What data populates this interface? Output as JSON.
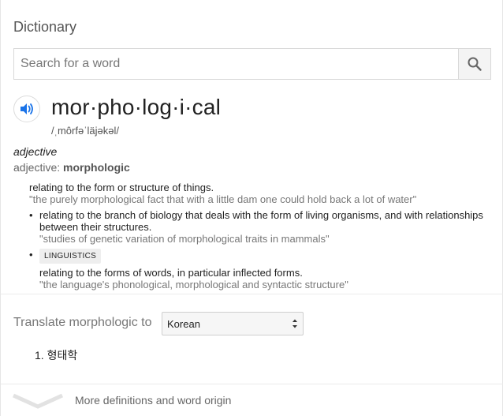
{
  "header": {
    "title": "Dictionary"
  },
  "search": {
    "placeholder": "Search for a word",
    "value": ""
  },
  "entry": {
    "headword": "mor·pho·log·i·cal",
    "phonetic": "/ˌmôrfəˈläjəkəl/",
    "part_of_speech": "adjective",
    "variant_prefix": "adjective:",
    "variant_word": "morphologic",
    "senses": [
      {
        "definition": "relating to the form or structure of things.",
        "example": "\"the purely morphological fact that with a little dam one could hold back a lot of water\""
      }
    ],
    "subsenses": [
      {
        "bullet": "•",
        "tag": "",
        "definition": "relating to the branch of biology that deals with the form of living organisms, and with relationships between their structures.",
        "example": "\"studies of genetic variation of morphological traits in mammals\""
      },
      {
        "bullet": "•",
        "tag": "LINGUISTICS",
        "definition": "relating to the forms of words, in particular inflected forms.",
        "example": "\"the language's phonological, morphological and syntactic structure\""
      }
    ]
  },
  "translate": {
    "label": "Translate morphologic to",
    "selected_language": "Korean",
    "results": [
      "1. 형태학"
    ]
  },
  "footer": {
    "more_label": "More definitions and word origin"
  },
  "icons": {
    "search": "search-icon",
    "speaker": "speaker-icon",
    "select_arrows": "select-arrows-icon",
    "chevron": "chevron-down-icon"
  },
  "colors": {
    "accent_blue": "#1a73e8",
    "muted_text": "#777777"
  }
}
